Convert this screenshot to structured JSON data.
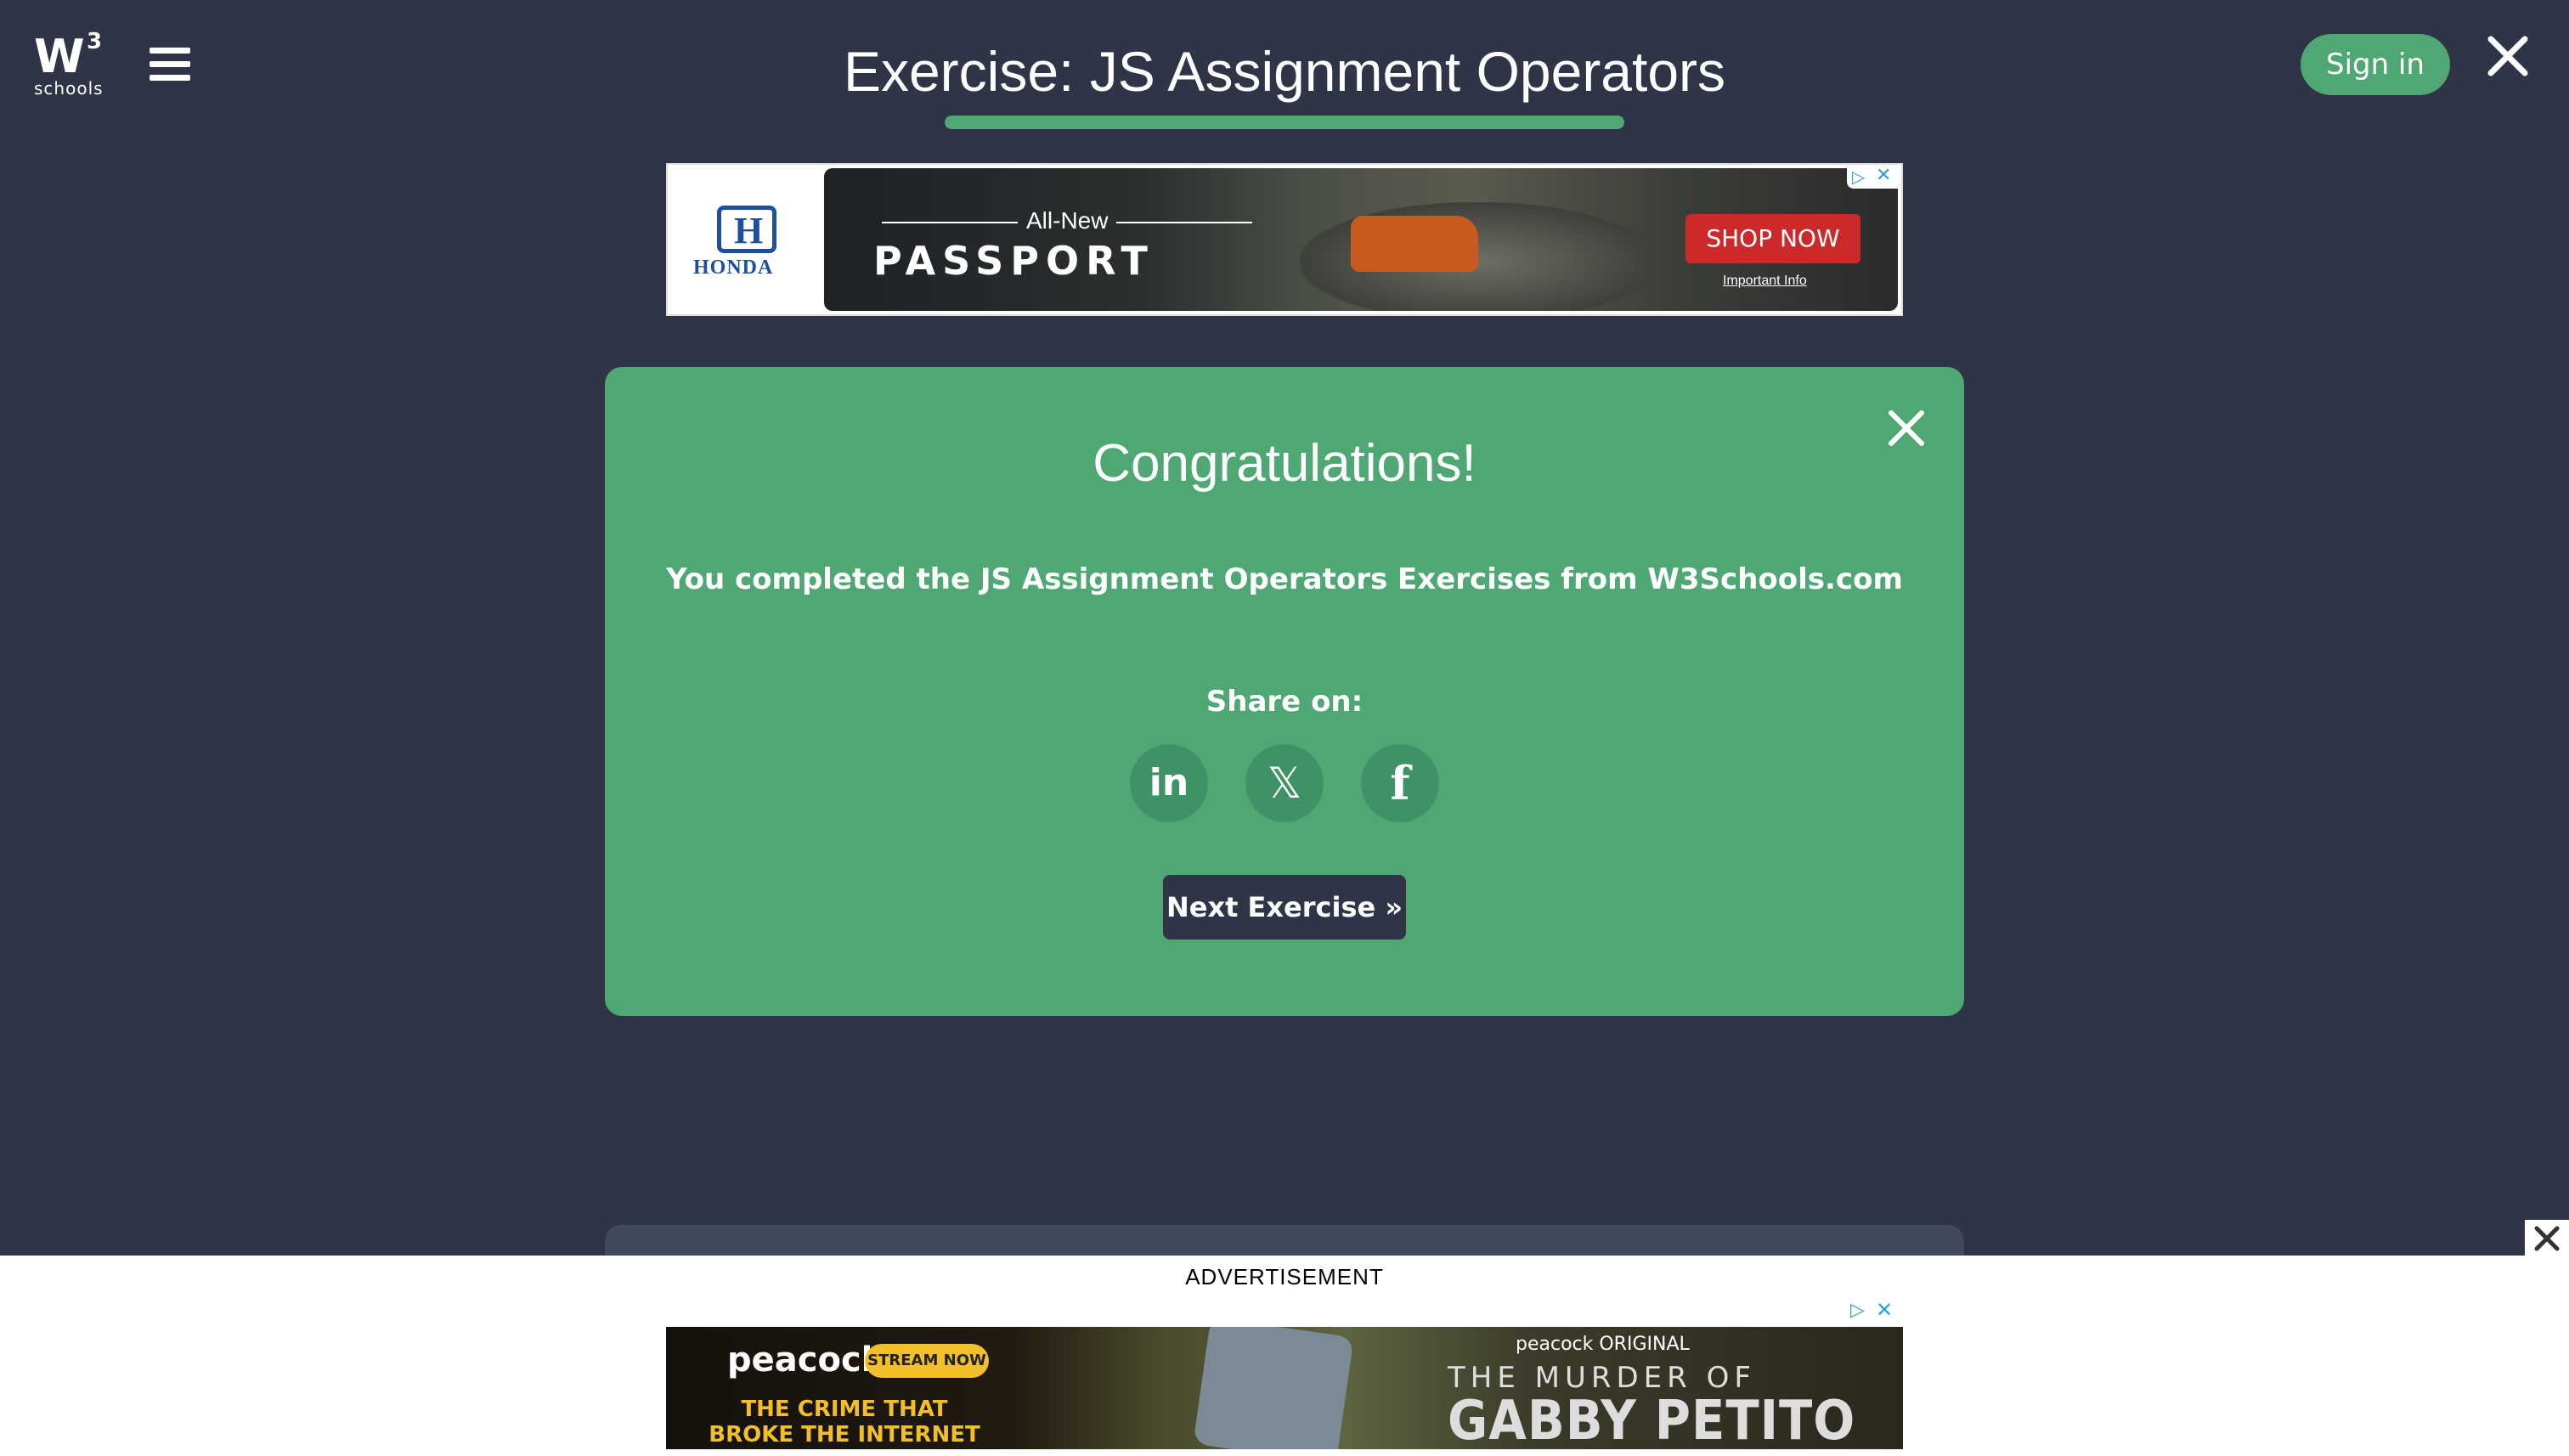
{
  "logo": {
    "mark": "W",
    "sup": "3",
    "sub": "schools"
  },
  "header": {
    "title": "Exercise: JS Assignment Operators",
    "signin_label": "Sign in"
  },
  "ad_top": {
    "brand": "HONDA",
    "tagline": "All-New",
    "product": "PASSPORT",
    "cta": "SHOP NOW",
    "info": "Important Info"
  },
  "card": {
    "title": "Congratulations!",
    "message": "You completed the JS Assignment Operators Exercises from W3Schools.com",
    "share_label": "Share on:",
    "share": {
      "linkedin": "in",
      "x": "𝕏",
      "facebook": "f"
    },
    "next_label": "Next Exercise »"
  },
  "bottom_ad": {
    "label": "ADVERTISEMENT",
    "brand": "peacock",
    "stream_label": "STREAM NOW",
    "tagline": "THE CRIME THAT BROKE THE INTERNET",
    "original": "peacock ORIGINAL",
    "title_line1": "THE MURDER OF",
    "title_line2": "GABBY PETITO"
  },
  "colors": {
    "background": "#2f3547",
    "accent_green": "#4fa774",
    "ad_red": "#cc2a2a"
  },
  "icons": [
    "menu-icon",
    "close-icon",
    "linkedin-icon",
    "x-icon",
    "facebook-icon",
    "adchoices-icon"
  ]
}
